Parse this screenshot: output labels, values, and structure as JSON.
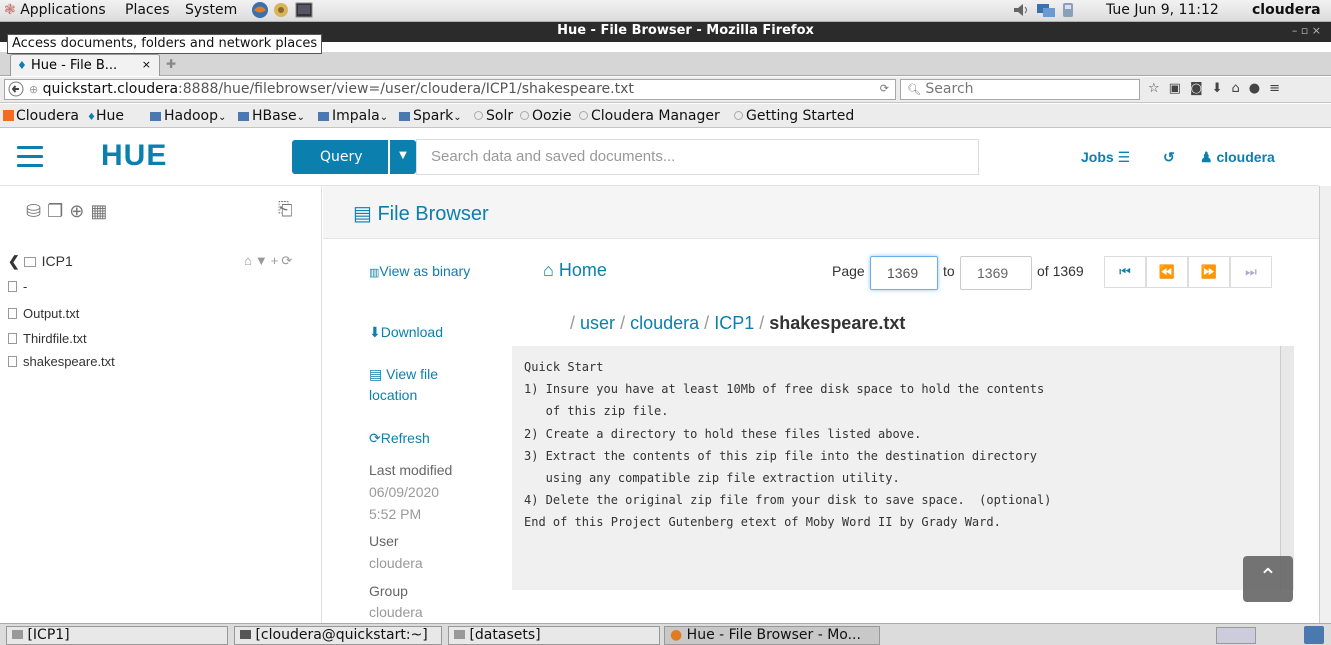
{
  "gnome_panel": {
    "menus": [
      "Applications",
      "Places",
      "System"
    ],
    "clock": "Tue Jun  9, 11:12",
    "user": "cloudera"
  },
  "window": {
    "title": "Hue - File Browser - Mozilla Firefox",
    "tooltip": "Access documents, folders and network places",
    "controls": "–  ▫  ×"
  },
  "tabs": [
    {
      "label": "Hue - File B..."
    }
  ],
  "browser": {
    "url_host": "quickstart.cloudera",
    "url_rest": ":8888/hue/filebrowser/view=/user/cloudera/ICP1/shakespeare.txt",
    "search_placeholder": "Search"
  },
  "bookmarks": [
    {
      "label": "Cloudera",
      "kind": "brand"
    },
    {
      "label": "Hue",
      "kind": "hue"
    },
    {
      "label": "Hadoop",
      "kind": "folder"
    },
    {
      "label": "HBase",
      "kind": "folder"
    },
    {
      "label": "Impala",
      "kind": "folder"
    },
    {
      "label": "Spark",
      "kind": "folder"
    },
    {
      "label": "Solr",
      "kind": "link"
    },
    {
      "label": "Oozie",
      "kind": "link"
    },
    {
      "label": "Cloudera Manager",
      "kind": "link"
    },
    {
      "label": "Getting Started",
      "kind": "link"
    }
  ],
  "hue": {
    "logo": "HUE",
    "query_label": "Query",
    "search_placeholder": "Search data and saved documents...",
    "jobs_label": "Jobs",
    "user_label": "cloudera",
    "accent": "#0b7fad"
  },
  "left_panel": {
    "folder": "ICP1",
    "items": [
      "-",
      "Output.txt",
      "Thirdfile.txt",
      "shakespeare.txt"
    ]
  },
  "file_browser": {
    "title": "File Browser",
    "actions": {
      "view_binary": "View as binary",
      "download": "Download",
      "view_location": "View file location",
      "refresh": "Refresh"
    },
    "meta": {
      "last_modified_label": "Last modified",
      "last_modified_date": "06/09/2020",
      "last_modified_time": "5:52 PM",
      "user_label": "User",
      "user_value": "cloudera",
      "group_label": "Group",
      "group_value": "cloudera"
    },
    "home_label": "Home",
    "pagination": {
      "page_label": "Page",
      "page_from": "1369",
      "to_label": "to",
      "page_to": "1369",
      "of_label": "of 1369"
    },
    "breadcrumb": {
      "user": "user",
      "cloudera": "cloudera",
      "icp1": "ICP1",
      "file": "shakespeare.txt"
    },
    "content_lines": [
      "Quick Start",
      "1) Insure you have at least 10Mb of free disk space to hold the contents",
      "   of this zip file.",
      "2) Create a directory to hold these files listed above.",
      "3) Extract the contents of this zip file into the destination directory",
      "   using any compatible zip file extraction utility.",
      "4) Delete the original zip file from your disk to save space.  (optional)",
      "",
      "",
      "End of this Project Gutenberg etext of Moby Word II by Grady Ward."
    ]
  },
  "taskbar": [
    {
      "label": "[ICP1]"
    },
    {
      "label": "[cloudera@quickstart:~]"
    },
    {
      "label": "[datasets]"
    },
    {
      "label": "Hue - File Browser - Mo..."
    }
  ]
}
